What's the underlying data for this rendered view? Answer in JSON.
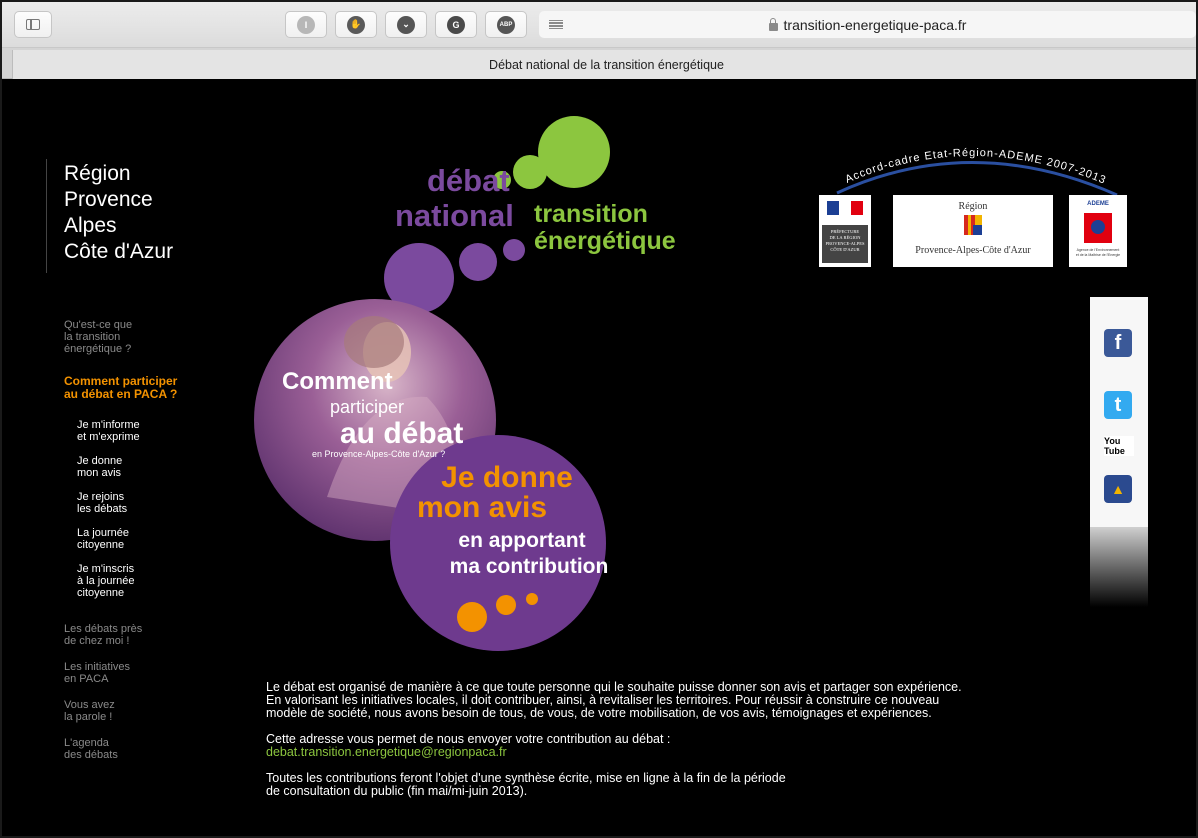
{
  "browser": {
    "url": "transition-energetique-paca.fr",
    "tab_title": "Débat national de la transition énergétique",
    "extensions": [
      {
        "name": "instapaper-icon",
        "glyph": "I",
        "color": "#b7b7b7"
      },
      {
        "name": "privacy-badger-icon",
        "glyph": "✋",
        "color": "#5a5a5a"
      },
      {
        "name": "pocket-icon",
        "glyph": "⌄",
        "color": "#555555"
      },
      {
        "name": "grammarly-icon",
        "glyph": "G",
        "color": "#4a4a4a"
      },
      {
        "name": "adblock-plus-icon",
        "glyph": "ABP",
        "color": "#555555"
      }
    ]
  },
  "region": {
    "title": "Région\nProvence\nAlpes\nCôte d'Azur"
  },
  "nav": {
    "items": [
      {
        "label": "Qu'est-ce que\nla transition\nénergétique ?",
        "type": "main"
      },
      {
        "label": "Comment participer\nau débat en PACA ?",
        "type": "active"
      },
      {
        "label": "Je m'informe\net m'exprime",
        "type": "sub"
      },
      {
        "label": "Je donne\nmon avis",
        "type": "sub"
      },
      {
        "label": "Je rejoins\nles débats",
        "type": "sub"
      },
      {
        "label": "La journée\ncitoyenne",
        "type": "sub"
      },
      {
        "label": "Je m'inscris\nà la journée\ncitoyenne",
        "type": "sub"
      },
      {
        "label": "Les débats près\nde chez moi !",
        "type": "main"
      },
      {
        "label": "Les initiatives\nen PACA",
        "type": "main"
      },
      {
        "label": "Vous avez\nla parole !",
        "type": "main"
      },
      {
        "label": "L'agenda\ndes débats",
        "type": "main"
      }
    ]
  },
  "logo": {
    "word1": "débat",
    "word2": "national",
    "word3": "transition",
    "word4": "énergétique",
    "purple": "#7b4a9e",
    "green": "#8cc63f"
  },
  "partners": {
    "arc_text": "Accord-cadre Etat-Région-ADEME 2007-2013",
    "prefecture_lines": "PRÉFECTURE\nDE LA RÉGION\nPROVENCE-ALPES\nCÔTE D'AZUR",
    "region_label": "Région",
    "region_name": "Provence-Alpes-Côte d'Azur",
    "ademe_label": "ADEME",
    "ademe_caption": "Agence de l'Environnement\net de la Maîtrise de l'Energie"
  },
  "hero": {
    "line1": "Comment",
    "line2": "participer",
    "line3": "au débat",
    "line4": "en Provence-Alpes-Côte d'Azur ?",
    "line5": "Je donne",
    "line6": "mon avis",
    "line7": "en apportant",
    "line8": "ma contribution",
    "orange": "#f39200"
  },
  "social": {
    "facebook": "f",
    "twitter": "t",
    "youtube": "You Tube",
    "dailymotion": "▲"
  },
  "content": {
    "para1": "Le débat est organisé de manière à ce que toute personne qui le souhaite puisse donner son avis et partager son expérience.\nEn valorisant les initiatives locales, il doit contribuer, ainsi, à revitaliser les territoires. Pour réussir à construire ce nouveau\nmodèle de société, nous avons besoin de tous, de vous, de votre mobilisation, de vos avis, témoignages et expériences.",
    "para2_intro": "Cette adresse vous permet de nous envoyer votre contribution au débat :",
    "email": "debat.transition.energetique@regionpaca.fr",
    "para3": "Toutes les contributions feront l'objet d'une synthèse écrite, mise en ligne à la fin de la période\nde consultation du public (fin mai/mi-juin 2013)."
  }
}
